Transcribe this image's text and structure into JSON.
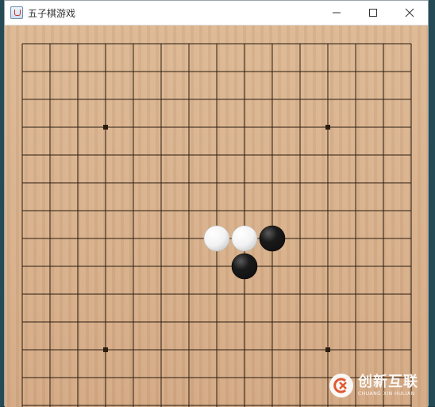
{
  "window": {
    "title": "五子棋游戏",
    "controls": [
      "minimize",
      "maximize",
      "close"
    ]
  },
  "board": {
    "lines": 15,
    "star_points": [
      [
        3,
        3
      ],
      [
        11,
        3
      ],
      [
        3,
        11
      ],
      [
        11,
        11
      ]
    ],
    "stones": [
      {
        "col": 7,
        "row": 7,
        "color": "white"
      },
      {
        "col": 8,
        "row": 7,
        "color": "white"
      },
      {
        "col": 9,
        "row": 7,
        "color": "black"
      },
      {
        "col": 8,
        "row": 8,
        "color": "black"
      }
    ],
    "colors": {
      "wood": "#d9b08a",
      "line": "#2b1d10",
      "black_stone": "#111111",
      "white_stone": "#f2f2f2"
    }
  },
  "watermark": {
    "brand": "创新互联",
    "sub": "CHUANG XIN HULIAN"
  },
  "icons": {
    "app": "java-cup-icon",
    "minimize": "minimize-icon",
    "maximize": "maximize-icon",
    "close": "close-icon"
  }
}
